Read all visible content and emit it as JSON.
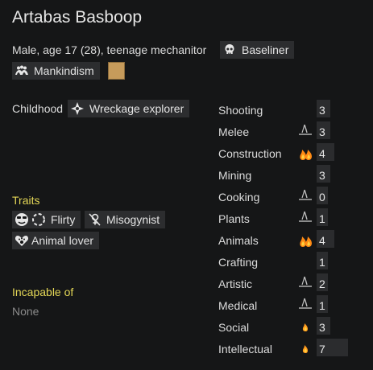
{
  "character": {
    "name": "Artabas Basboop",
    "description": "Male, age 17 (28), teenage mechanitor",
    "xenotype": "Baseliner",
    "ideology": "Mankindism",
    "favorite_color": "#c69b5b"
  },
  "background": {
    "childhood_label": "Childhood",
    "childhood_value": "Wreckage explorer"
  },
  "traits": {
    "header": "Traits",
    "items": [
      "Flirty",
      "Misogynist",
      "Animal lover"
    ]
  },
  "incapable": {
    "header": "Incapable of",
    "value": "None"
  },
  "skills": [
    {
      "name": "Shooting",
      "value": "3",
      "passion": "none",
      "level": 0.15
    },
    {
      "name": "Melee",
      "value": "3",
      "passion": "unused",
      "level": 0.15
    },
    {
      "name": "Construction",
      "value": "4",
      "passion": "major",
      "level": 0.2
    },
    {
      "name": "Mining",
      "value": "3",
      "passion": "none",
      "level": 0.15
    },
    {
      "name": "Cooking",
      "value": "0",
      "passion": "unused",
      "level": 0.0
    },
    {
      "name": "Plants",
      "value": "1",
      "passion": "unused",
      "level": 0.05
    },
    {
      "name": "Animals",
      "value": "4",
      "passion": "major",
      "level": 0.2
    },
    {
      "name": "Crafting",
      "value": "1",
      "passion": "none",
      "level": 0.05
    },
    {
      "name": "Artistic",
      "value": "2",
      "passion": "unused",
      "level": 0.1
    },
    {
      "name": "Medical",
      "value": "1",
      "passion": "unused",
      "level": 0.05
    },
    {
      "name": "Social",
      "value": "3",
      "passion": "minor",
      "level": 0.15
    },
    {
      "name": "Intellectual",
      "value": "7",
      "passion": "minor",
      "level": 0.35
    }
  ]
}
